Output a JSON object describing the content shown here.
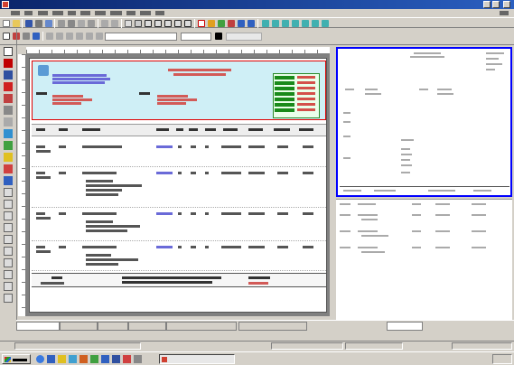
{
  "window": {},
  "menu": {},
  "toolbar": {},
  "invoice": {},
  "tabs": [
    {
      "label": ""
    },
    {
      "label": ""
    },
    {
      "label": ""
    },
    {
      "label": ""
    },
    {
      "label": ""
    },
    {
      "label": ""
    },
    {
      "label": ""
    }
  ],
  "statusbar": {},
  "taskbar": {}
}
